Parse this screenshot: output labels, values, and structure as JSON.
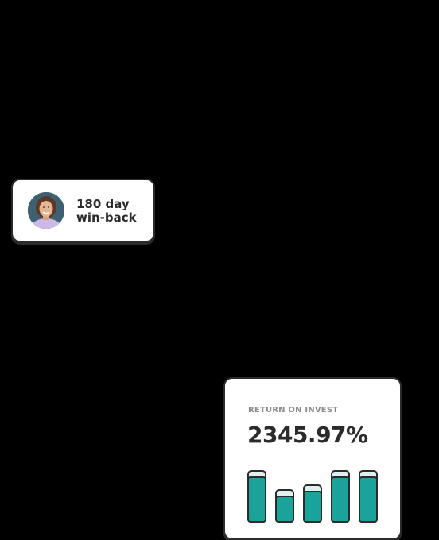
{
  "winback_badge": {
    "line1": "180 day",
    "line2": "win-back",
    "avatar_icon": "person-avatar"
  },
  "roi_card": {
    "label": "RETURN ON INVEST",
    "value": "2345.97%"
  },
  "chart_data": {
    "type": "bar",
    "values": [
      1.0,
      0.62,
      0.72,
      1.0,
      1.0
    ],
    "fill_color": "#1aa39a",
    "track_color": "#dff1ee",
    "outline_color": "#2b2b2b"
  }
}
